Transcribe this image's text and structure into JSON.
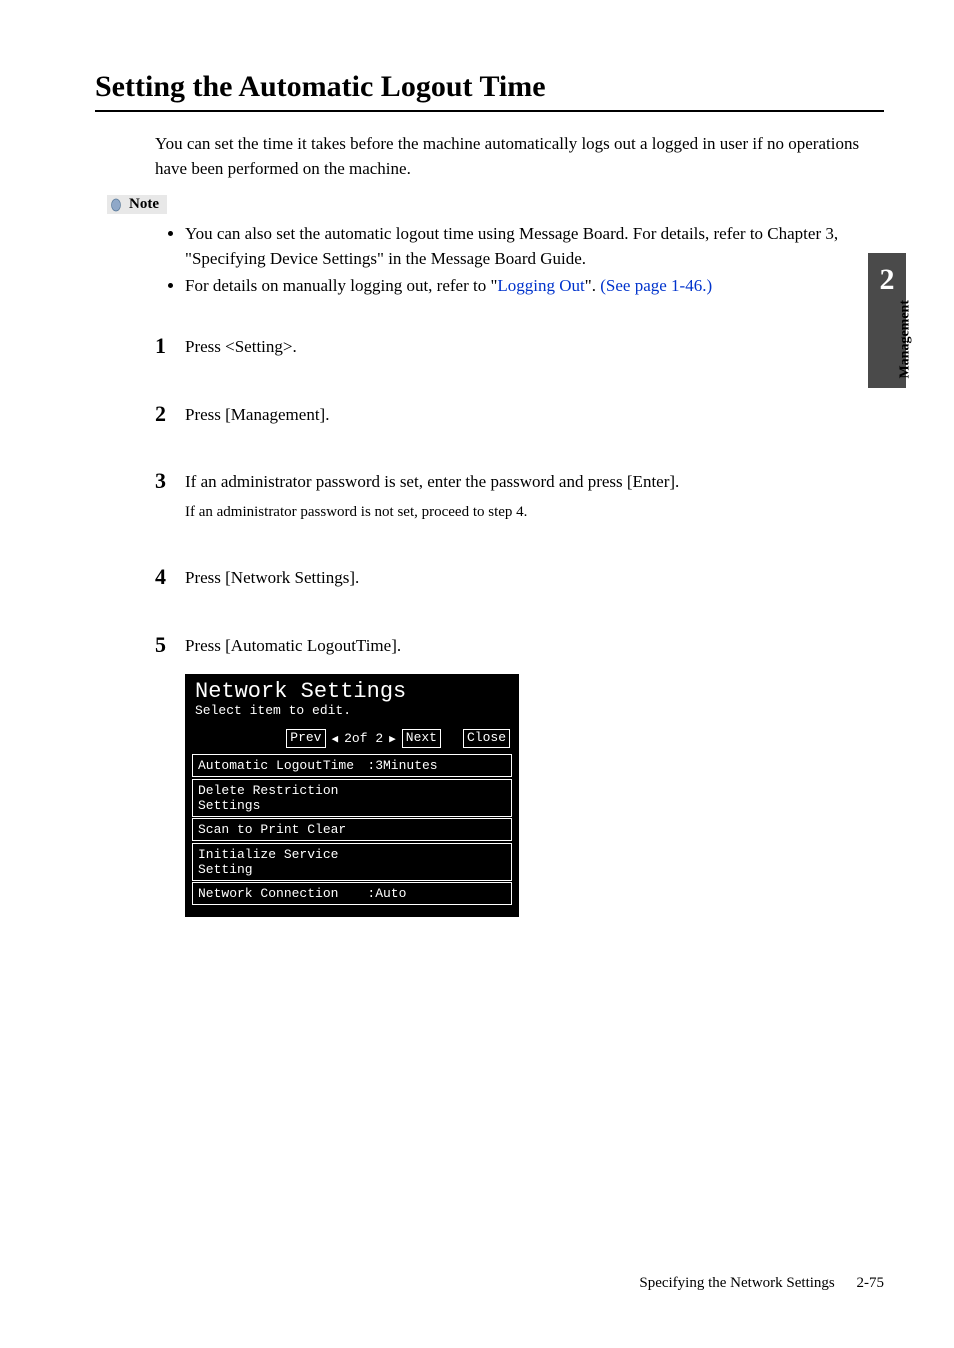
{
  "heading": "Setting the Automatic Logout Time",
  "intro": "You can set the time it takes before the machine automatically logs out a logged in user if no operations have been performed on the machine.",
  "note": {
    "label": "Note",
    "items": [
      {
        "text": "You can also set the automatic logout time using Message Board. For details, refer to Chapter 3, \"Specifying Device Settings\" in the Message Board Guide."
      },
      {
        "prefix": "For details on manually logging out, refer to \"",
        "link_text": "Logging Out",
        "mid": "\". ",
        "link_text2": "(See page 1-46.)"
      }
    ]
  },
  "steps": [
    {
      "num": "1",
      "text": "Press <Setting>."
    },
    {
      "num": "2",
      "text": "Press [Management]."
    },
    {
      "num": "3",
      "text": "If an administrator password is set, enter the password and press [Enter].",
      "sub": "If an administrator password is not set, proceed to step 4."
    },
    {
      "num": "4",
      "text": "Press [Network Settings]."
    },
    {
      "num": "5",
      "text": "Press [Automatic LogoutTime]."
    }
  ],
  "lcd": {
    "title": "Network Settings",
    "subtitle": "Select item to edit.",
    "prev": "Prev",
    "page_indicator": "2of 2",
    "next": "Next",
    "close": "Close",
    "items": [
      {
        "label": "Automatic LogoutTime",
        "value": ":3Minutes"
      },
      {
        "label": "Delete Restriction Settings",
        "value": ""
      },
      {
        "label": "Scan to Print Clear",
        "value": ""
      },
      {
        "label": "Initialize Service Setting",
        "value": ""
      },
      {
        "label": "Network Connection",
        "value": ":Auto"
      }
    ]
  },
  "side": {
    "number": "2",
    "label": "Management"
  },
  "footer": {
    "section": "Specifying the Network Settings",
    "page": "2-75"
  }
}
